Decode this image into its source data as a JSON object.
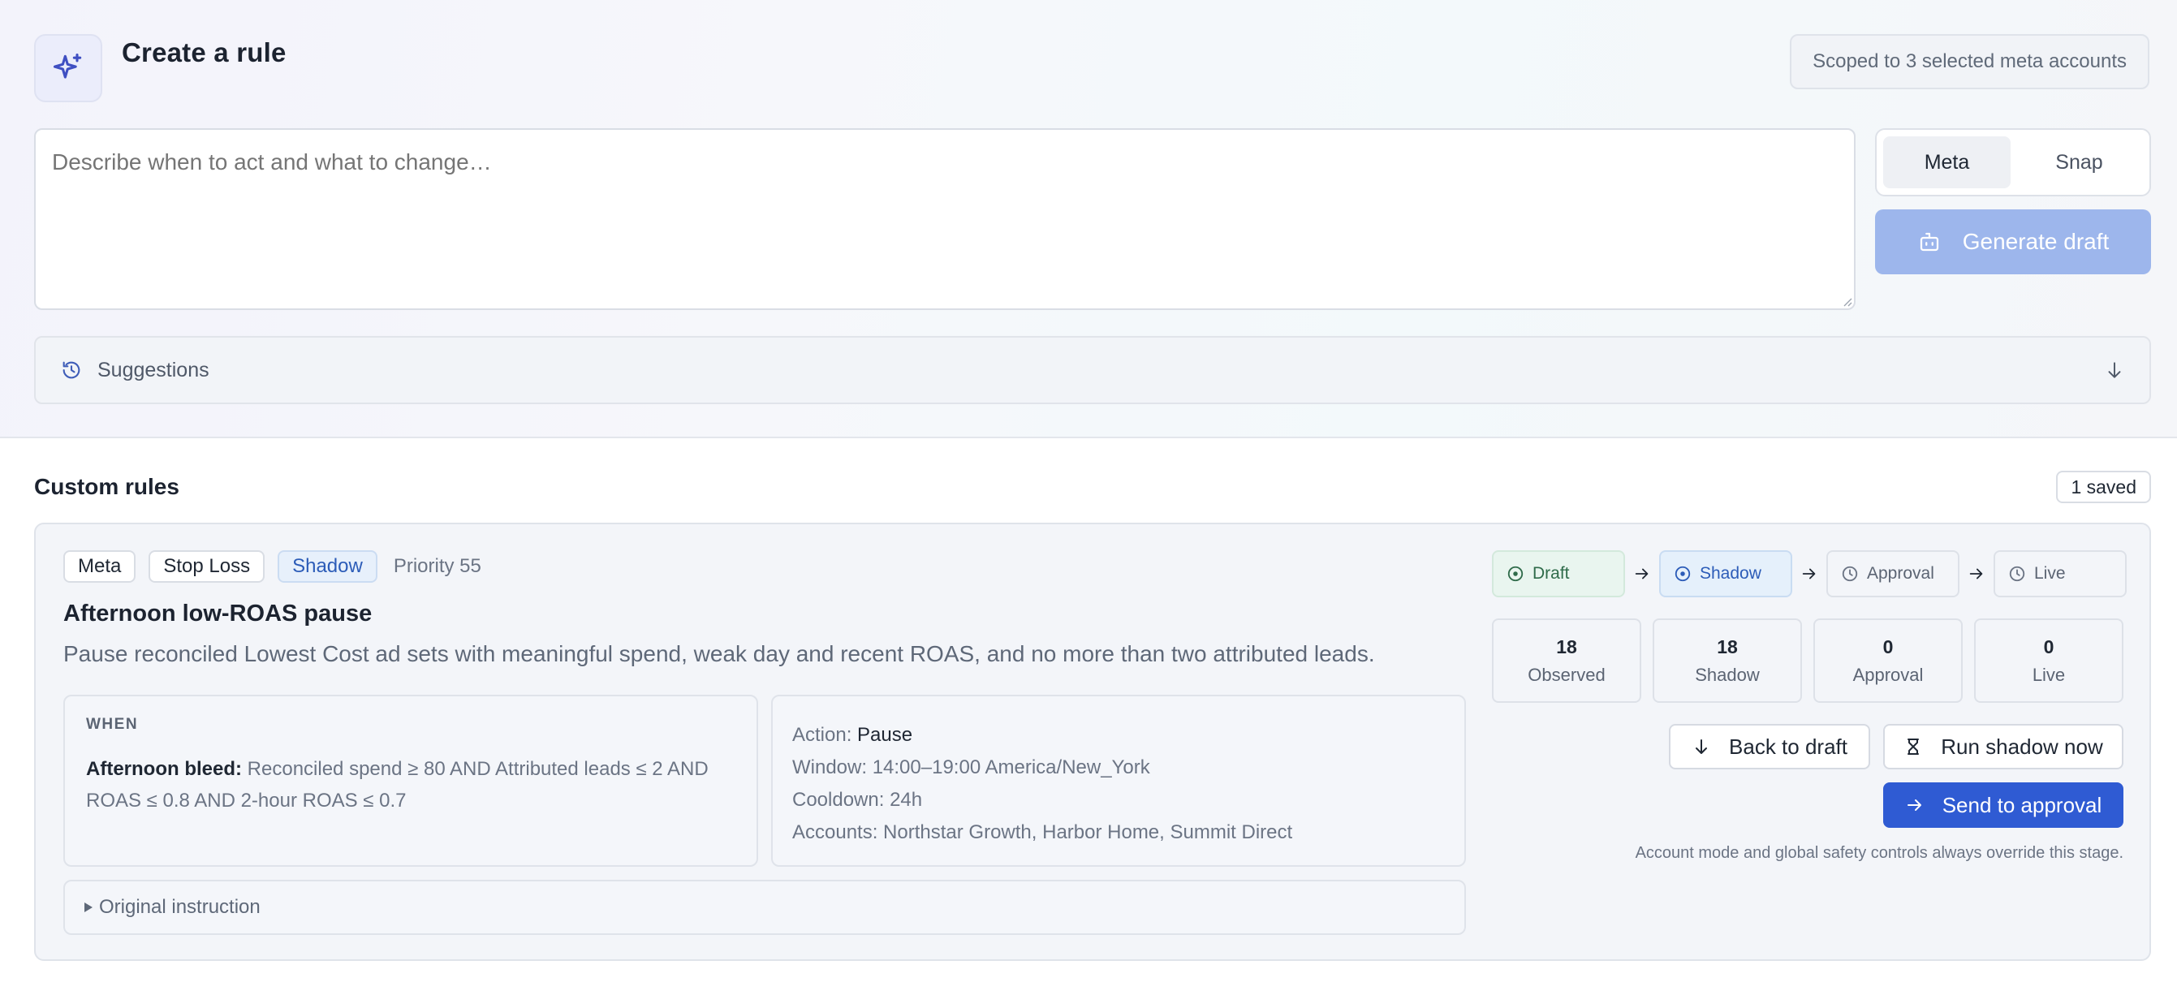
{
  "create": {
    "title": "Create a rule",
    "scope": "Scoped to 3 selected meta accounts",
    "prompt_placeholder": "Describe when to act and what to change…",
    "prompt_value": "",
    "platforms": [
      "Meta",
      "Snap"
    ],
    "selected_platform": "Meta",
    "generate_label": "Generate draft",
    "suggestions_label": "Suggestions",
    "accent_color": "#2f5bd3",
    "disabled_button_color": "#9db6ec"
  },
  "rules": {
    "title": "Custom rules",
    "saved": "1 saved",
    "items": [
      {
        "tags": [
          "Meta",
          "Stop Loss",
          "Shadow"
        ],
        "priority": "Priority 55",
        "name": "Afternoon low-ROAS pause",
        "description": "Pause reconciled Lowest Cost ad sets with meaningful spend, weak day and recent ROAS, and no more than two attributed leads.",
        "when_label": "WHEN",
        "when_title": "Afternoon bleed:",
        "when_condition": "Reconciled spend ≥ 80 AND Attributed leads ≤ 2 AND ROAS ≤ 0.8 AND 2-hour ROAS ≤ 0.7",
        "action_key": "Action:",
        "action_value": "Pause",
        "window": "Window: 14:00–19:00 America/New_York",
        "cooldown": "Cooldown: 24h",
        "accounts": "Accounts: Northstar Growth, Harbor Home, Summit Direct",
        "original_instruction": "Original instruction",
        "stages": [
          "Draft",
          "Shadow",
          "Approval",
          "Live"
        ],
        "current_stage": "Shadow",
        "counts": [
          {
            "value": "18",
            "label": "Observed"
          },
          {
            "value": "18",
            "label": "Shadow"
          },
          {
            "value": "0",
            "label": "Approval"
          },
          {
            "value": "0",
            "label": "Live"
          }
        ],
        "back_label": "Back to draft",
        "run_label": "Run shadow now",
        "send_label": "Send to approval",
        "note": "Account mode and global safety controls always override this stage."
      }
    ]
  },
  "icons": {
    "brand": "sparkles-icon",
    "generate": "bot-icon",
    "suggestions": "history-icon",
    "suggestions_toggle": "arrow-down-icon",
    "stage_draft": "circle-dot-icon",
    "stage_shadow": "circle-dot-icon",
    "stage_pending": "clock-icon",
    "stage_arrow": "arrow-right-icon",
    "back": "arrow-down-icon",
    "run": "hourglass-icon",
    "send": "arrow-right-icon",
    "expand": "triangle-right-icon"
  }
}
